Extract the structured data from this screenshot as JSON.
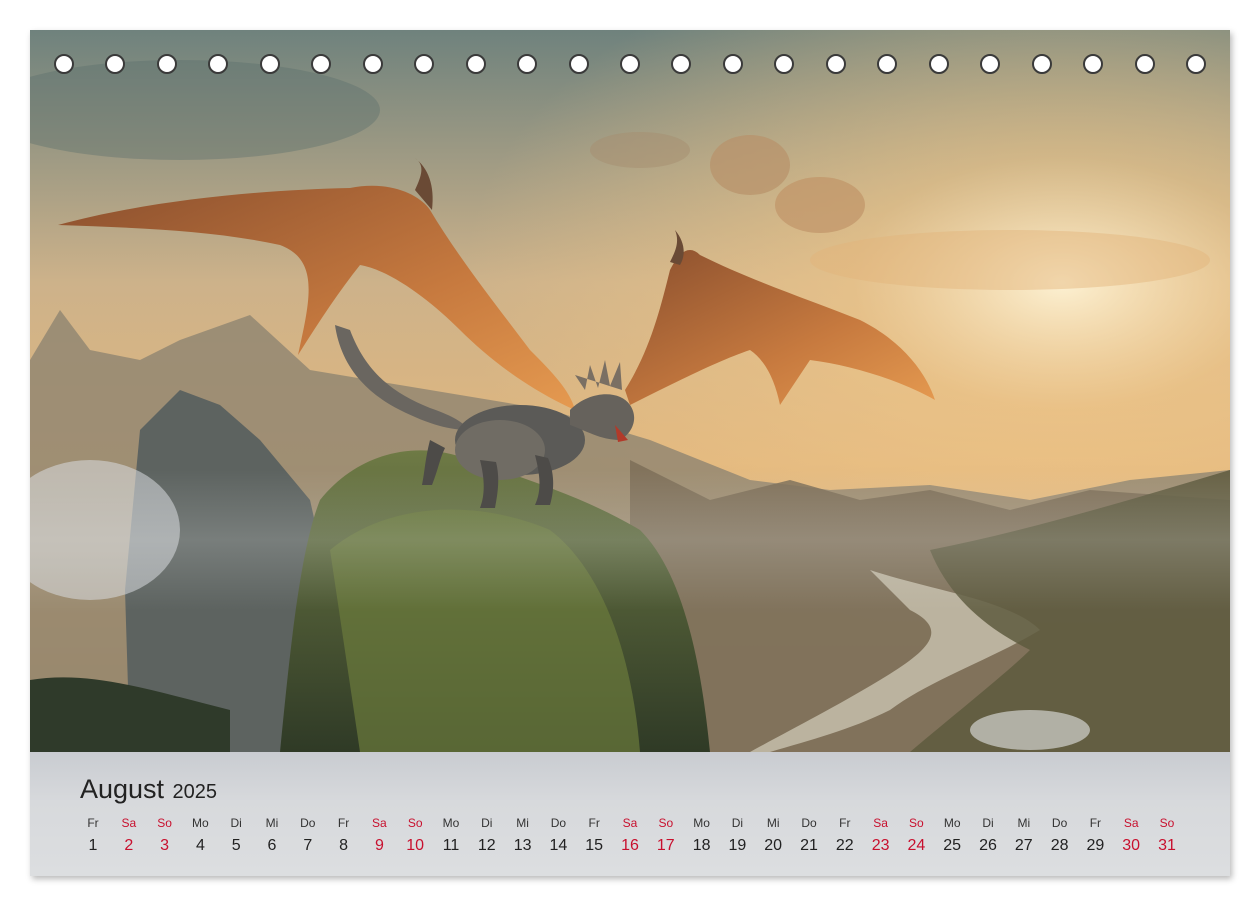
{
  "calendar": {
    "month": "August",
    "year": "2025",
    "weekend_color": "#c8102e",
    "days": [
      {
        "wd": "Fr",
        "d": "1",
        "we": false
      },
      {
        "wd": "Sa",
        "d": "2",
        "we": true
      },
      {
        "wd": "So",
        "d": "3",
        "we": true
      },
      {
        "wd": "Mo",
        "d": "4",
        "we": false
      },
      {
        "wd": "Di",
        "d": "5",
        "we": false
      },
      {
        "wd": "Mi",
        "d": "6",
        "we": false
      },
      {
        "wd": "Do",
        "d": "7",
        "we": false
      },
      {
        "wd": "Fr",
        "d": "8",
        "we": false
      },
      {
        "wd": "Sa",
        "d": "9",
        "we": true
      },
      {
        "wd": "So",
        "d": "10",
        "we": true
      },
      {
        "wd": "Mo",
        "d": "11",
        "we": false
      },
      {
        "wd": "Di",
        "d": "12",
        "we": false
      },
      {
        "wd": "Mi",
        "d": "13",
        "we": false
      },
      {
        "wd": "Do",
        "d": "14",
        "we": false
      },
      {
        "wd": "Fr",
        "d": "15",
        "we": false
      },
      {
        "wd": "Sa",
        "d": "16",
        "we": true
      },
      {
        "wd": "So",
        "d": "17",
        "we": true
      },
      {
        "wd": "Mo",
        "d": "18",
        "we": false
      },
      {
        "wd": "Di",
        "d": "19",
        "we": false
      },
      {
        "wd": "Mi",
        "d": "20",
        "we": false
      },
      {
        "wd": "Do",
        "d": "21",
        "we": false
      },
      {
        "wd": "Fr",
        "d": "22",
        "we": false
      },
      {
        "wd": "Sa",
        "d": "23",
        "we": true
      },
      {
        "wd": "So",
        "d": "24",
        "we": true
      },
      {
        "wd": "Mo",
        "d": "25",
        "we": false
      },
      {
        "wd": "Di",
        "d": "26",
        "we": false
      },
      {
        "wd": "Mi",
        "d": "27",
        "we": false
      },
      {
        "wd": "Do",
        "d": "28",
        "we": false
      },
      {
        "wd": "Fr",
        "d": "29",
        "we": false
      },
      {
        "wd": "Sa",
        "d": "30",
        "we": true
      },
      {
        "wd": "So",
        "d": "31",
        "we": true
      }
    ]
  },
  "binding_hole_count": 23,
  "photo": {
    "subject": "dragon-flying-over-mountains"
  }
}
